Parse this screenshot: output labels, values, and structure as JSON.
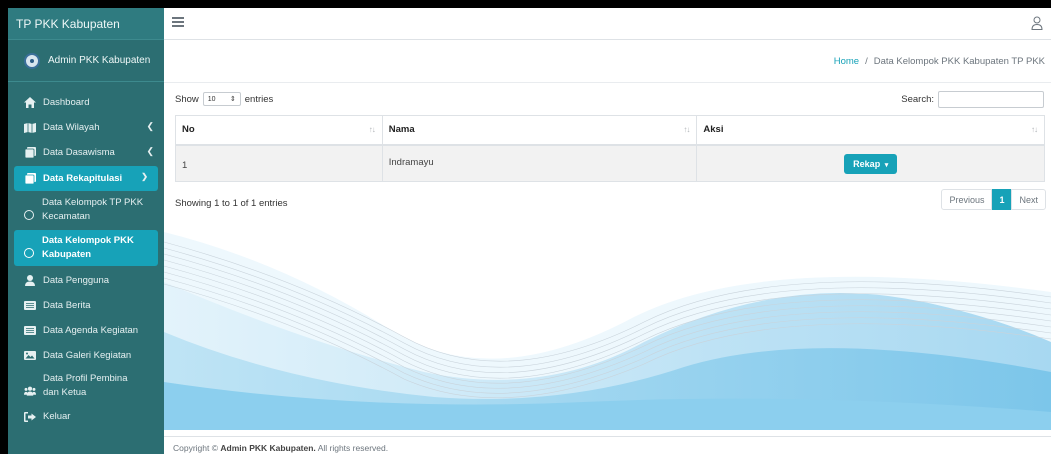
{
  "brand": {
    "title": "TP PKK Kabupaten"
  },
  "user": {
    "name": "Admin PKK Kabupaten"
  },
  "colors": {
    "sidebar": "#2c6e72",
    "accent": "#17a2b8",
    "wave": "#9fd3ee"
  },
  "sidebar": {
    "items": [
      {
        "label": "Dashboard",
        "icon": "home-icon"
      },
      {
        "label": "Data Wilayah",
        "icon": "map-icon"
      },
      {
        "label": "Data Dasawisma",
        "icon": "copy-icon"
      },
      {
        "label": "Data Rekapitulasi",
        "icon": "copy-icon"
      },
      {
        "label_line1": "Data Kelompok TP PKK",
        "label_line2": "Kecamatan",
        "icon": "circle-icon"
      },
      {
        "label_line1": "Data Kelompok PKK",
        "label_line2": "Kabupaten",
        "icon": "circle-icon"
      },
      {
        "label": "Data Pengguna",
        "icon": "user-icon"
      },
      {
        "label": "Data Berita",
        "icon": "newspaper-icon"
      },
      {
        "label": "Data Agenda Kegiatan",
        "icon": "newspaper-icon"
      },
      {
        "label": "Data Galeri Kegiatan",
        "icon": "image-icon"
      },
      {
        "label_line1": "Data Profil Pembina",
        "label_line2": "dan Ketua",
        "icon": "users-icon"
      },
      {
        "label": "Keluar",
        "icon": "sign-out-icon"
      }
    ]
  },
  "breadcrumb": {
    "home": "Home",
    "separator": "/",
    "current": "Data Kelompok PKK Kabupaten TP PKK"
  },
  "table_controls": {
    "show": "Show",
    "length_value": "10",
    "entries": "entries",
    "search_label": "Search:"
  },
  "table": {
    "headers": [
      "No",
      "Nama",
      "Aksi"
    ],
    "rows": [
      {
        "no": "1",
        "nama": "Indramayu",
        "action": "Rekap"
      }
    ]
  },
  "info": "Showing 1 to 1 of 1 entries",
  "pagination": {
    "previous": "Previous",
    "current": "1",
    "next": "Next"
  },
  "footer": {
    "prefix": "Copyright ©",
    "name": "Admin PKK Kabupaten.",
    "suffix": "All rights reserved."
  }
}
